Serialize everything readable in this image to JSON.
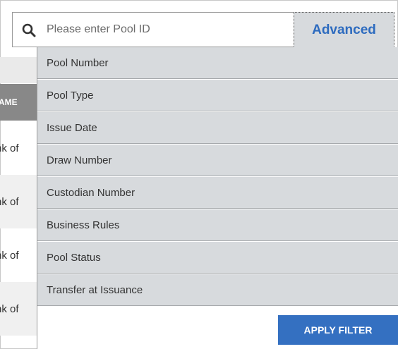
{
  "search": {
    "placeholder": "Please enter Pool ID",
    "value": "",
    "advanced_label": "Advanced"
  },
  "background_table": {
    "header_fragment": "AME",
    "row_fragments": [
      "nk of",
      "nk of",
      "nk of",
      "nk of"
    ]
  },
  "filter_menu": {
    "items": [
      {
        "label": "Pool Number"
      },
      {
        "label": "Pool Type"
      },
      {
        "label": "Issue Date"
      },
      {
        "label": "Draw Number"
      },
      {
        "label": "Custodian Number"
      },
      {
        "label": "Business Rules"
      },
      {
        "label": "Pool Status"
      },
      {
        "label": "Transfer at Issuance"
      }
    ],
    "apply_label": "APPLY FILTER"
  },
  "colors": {
    "accent": "#3470c1",
    "advanced_text": "#2d6bbf",
    "menu_bg": "#d7dadd",
    "header_dark": "#888888"
  }
}
